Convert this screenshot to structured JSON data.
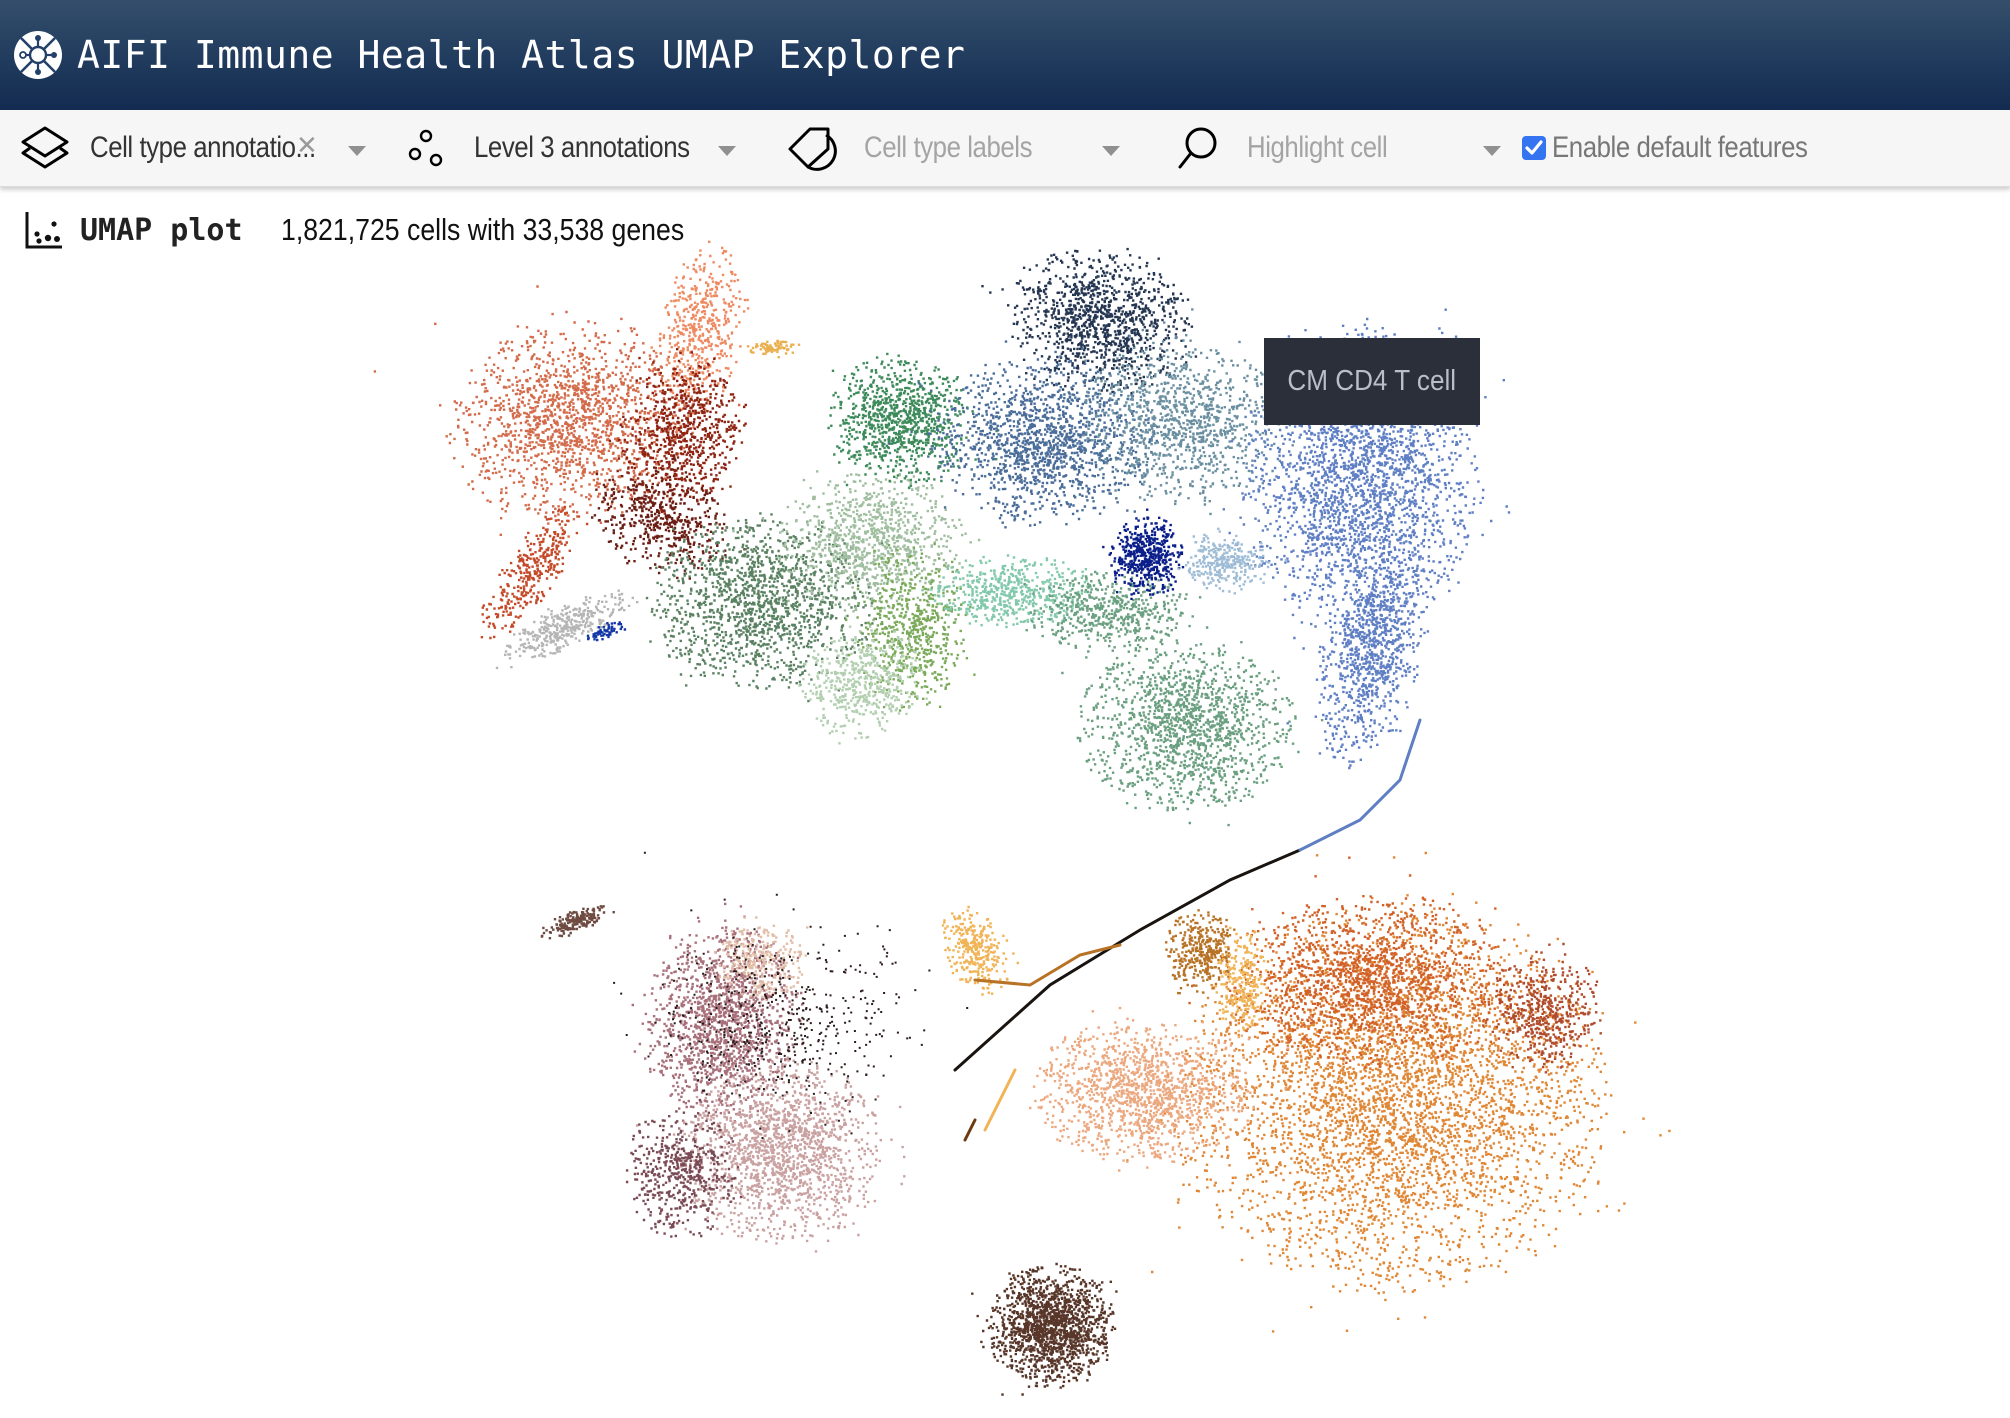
{
  "header": {
    "title": "AIFI Immune Health Atlas UMAP Explorer",
    "logo_icon": "network-hub-icon"
  },
  "toolbar": {
    "color_by": {
      "icon": "layers-icon",
      "value": "Cell type annotatio...",
      "has_clear": true
    },
    "annotation_level": {
      "icon": "scatter-dots-icon",
      "value": "Level 3 annotations"
    },
    "labels": {
      "icon": "tag-icon",
      "placeholder": "Cell type labels"
    },
    "highlight": {
      "icon": "search-icon",
      "placeholder": "Highlight cell"
    },
    "default_features": {
      "label": "Enable default features",
      "checked": true,
      "color": "#3574f0"
    }
  },
  "plot": {
    "icon": "scatter-plot-icon",
    "title": "UMAP plot",
    "summary": "1,821,725 cells with 33,538 genes",
    "cell_count": 1821725,
    "gene_count": 33538,
    "tooltip": "CM CD4 T cell",
    "cluster_palette": {
      "myeloid_monocytes": [
        "#d36a49",
        "#ee8a62",
        "#8f2312",
        "#6b1e14",
        "#c44a2a"
      ],
      "nk_cells": [
        "#5a8262",
        "#9fbd9f",
        "#7aaa5a",
        "#82c8aa",
        "#b2cfb0"
      ],
      "cd8_t_cells": [
        "#3d8a5a",
        "#6a9f80"
      ],
      "cd4_t_cells": [
        "#253652",
        "#4a6d9a",
        "#5f7fc4",
        "#6a8fa0",
        "#0b1f8a",
        "#9fbcd6"
      ],
      "b_cells": [
        "#a8707a",
        "#caa1a1",
        "#7a4b55",
        "#e2bda8",
        "#2a1a1a"
      ],
      "progenitor_misc": [
        "#e08735",
        "#d16126",
        "#b04c2c",
        "#eba87f",
        "#f0b356",
        "#b87225",
        "#2a1a14"
      ],
      "platelets": [
        "#583629"
      ],
      "doublets_other": [
        "#b5b5b5",
        "#1236a5",
        "#eab050",
        "#6e4a40"
      ]
    }
  }
}
